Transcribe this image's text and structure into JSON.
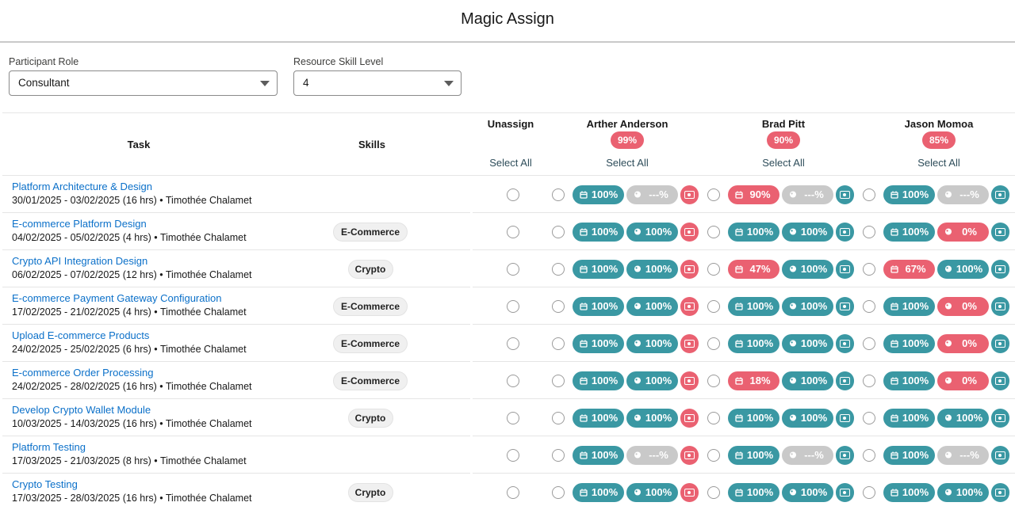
{
  "header": {
    "title": "Magic Assign"
  },
  "filters": {
    "role": {
      "label": "Participant Role",
      "value": "Consultant"
    },
    "skill_level": {
      "label": "Resource Skill Level",
      "value": "4"
    }
  },
  "columns": {
    "task": "Task",
    "skills": "Skills",
    "unassign": {
      "name": "Unassign",
      "select_all": "Select All"
    },
    "resources": [
      {
        "name": "Arther Anderson",
        "match": "99%",
        "select_all": "Select All"
      },
      {
        "name": "Brad Pitt",
        "match": "90%",
        "select_all": "Select All"
      },
      {
        "name": "Jason Momoa",
        "match": "85%",
        "select_all": "Select All"
      }
    ]
  },
  "legend_icons": {
    "availability": "calendar-icon",
    "skill": "skill-badge-icon",
    "cost": "money-icon"
  },
  "status_colors": {
    "good": "#3a98a3",
    "bad": "#ea6171",
    "na": "#c9c9c9",
    "link": "#0b70c9"
  },
  "tasks": [
    {
      "name": "Platform Architecture & Design",
      "dates": "30/01/2025 - 03/02/2025 (16 hrs)",
      "owner": "Timothée Chalamet",
      "skill": "",
      "cells": [
        {
          "avail": "100%",
          "avail_s": "good",
          "skill": "---%",
          "skill_s": "na",
          "cost_s": "bad"
        },
        {
          "avail": "90%",
          "avail_s": "bad",
          "skill": "---%",
          "skill_s": "na",
          "cost_s": "good"
        },
        {
          "avail": "100%",
          "avail_s": "good",
          "skill": "---%",
          "skill_s": "na",
          "cost_s": "good"
        }
      ]
    },
    {
      "name": "E-commerce Platform Design",
      "dates": "04/02/2025 - 05/02/2025 (4 hrs)",
      "owner": "Timothée Chalamet",
      "skill": "E-Commerce",
      "cells": [
        {
          "avail": "100%",
          "avail_s": "good",
          "skill": "100%",
          "skill_s": "good",
          "cost_s": "bad"
        },
        {
          "avail": "100%",
          "avail_s": "good",
          "skill": "100%",
          "skill_s": "good",
          "cost_s": "good"
        },
        {
          "avail": "100%",
          "avail_s": "good",
          "skill": "0%",
          "skill_s": "bad",
          "cost_s": "good"
        }
      ]
    },
    {
      "name": "Crypto API Integration Design",
      "dates": "06/02/2025 - 07/02/2025 (12 hrs)",
      "owner": "Timothée Chalamet",
      "skill": "Crypto",
      "cells": [
        {
          "avail": "100%",
          "avail_s": "good",
          "skill": "100%",
          "skill_s": "good",
          "cost_s": "bad"
        },
        {
          "avail": "47%",
          "avail_s": "bad",
          "skill": "100%",
          "skill_s": "good",
          "cost_s": "good"
        },
        {
          "avail": "67%",
          "avail_s": "bad",
          "skill": "100%",
          "skill_s": "good",
          "cost_s": "good"
        }
      ]
    },
    {
      "name": "E-commerce Payment Gateway Configuration",
      "dates": "17/02/2025 - 21/02/2025 (4 hrs)",
      "owner": "Timothée Chalamet",
      "skill": "E-Commerce",
      "cells": [
        {
          "avail": "100%",
          "avail_s": "good",
          "skill": "100%",
          "skill_s": "good",
          "cost_s": "bad"
        },
        {
          "avail": "100%",
          "avail_s": "good",
          "skill": "100%",
          "skill_s": "good",
          "cost_s": "good"
        },
        {
          "avail": "100%",
          "avail_s": "good",
          "skill": "0%",
          "skill_s": "bad",
          "cost_s": "good"
        }
      ]
    },
    {
      "name": "Upload E-commerce Products",
      "dates": "24/02/2025 - 25/02/2025 (6 hrs)",
      "owner": "Timothée Chalamet",
      "skill": "E-Commerce",
      "cells": [
        {
          "avail": "100%",
          "avail_s": "good",
          "skill": "100%",
          "skill_s": "good",
          "cost_s": "bad"
        },
        {
          "avail": "100%",
          "avail_s": "good",
          "skill": "100%",
          "skill_s": "good",
          "cost_s": "good"
        },
        {
          "avail": "100%",
          "avail_s": "good",
          "skill": "0%",
          "skill_s": "bad",
          "cost_s": "good"
        }
      ]
    },
    {
      "name": "E-commerce Order Processing",
      "dates": "24/02/2025 - 28/02/2025 (16 hrs)",
      "owner": "Timothée Chalamet",
      "skill": "E-Commerce",
      "cells": [
        {
          "avail": "100%",
          "avail_s": "good",
          "skill": "100%",
          "skill_s": "good",
          "cost_s": "bad"
        },
        {
          "avail": "18%",
          "avail_s": "bad",
          "skill": "100%",
          "skill_s": "good",
          "cost_s": "good"
        },
        {
          "avail": "100%",
          "avail_s": "good",
          "skill": "0%",
          "skill_s": "bad",
          "cost_s": "good"
        }
      ]
    },
    {
      "name": "Develop Crypto Wallet Module",
      "dates": "10/03/2025 - 14/03/2025 (16 hrs)",
      "owner": "Timothée Chalamet",
      "skill": "Crypto",
      "cells": [
        {
          "avail": "100%",
          "avail_s": "good",
          "skill": "100%",
          "skill_s": "good",
          "cost_s": "bad"
        },
        {
          "avail": "100%",
          "avail_s": "good",
          "skill": "100%",
          "skill_s": "good",
          "cost_s": "good"
        },
        {
          "avail": "100%",
          "avail_s": "good",
          "skill": "100%",
          "skill_s": "good",
          "cost_s": "good"
        }
      ]
    },
    {
      "name": "Platform Testing",
      "dates": "17/03/2025 - 21/03/2025 (8 hrs)",
      "owner": "Timothée Chalamet",
      "skill": "",
      "cells": [
        {
          "avail": "100%",
          "avail_s": "good",
          "skill": "---%",
          "skill_s": "na",
          "cost_s": "bad"
        },
        {
          "avail": "100%",
          "avail_s": "good",
          "skill": "---%",
          "skill_s": "na",
          "cost_s": "good"
        },
        {
          "avail": "100%",
          "avail_s": "good",
          "skill": "---%",
          "skill_s": "na",
          "cost_s": "good"
        }
      ]
    },
    {
      "name": "Crypto Testing",
      "dates": "17/03/2025 - 28/03/2025 (16 hrs)",
      "owner": "Timothée Chalamet",
      "skill": "Crypto",
      "cells": [
        {
          "avail": "100%",
          "avail_s": "good",
          "skill": "100%",
          "skill_s": "good",
          "cost_s": "bad"
        },
        {
          "avail": "100%",
          "avail_s": "good",
          "skill": "100%",
          "skill_s": "good",
          "cost_s": "good"
        },
        {
          "avail": "100%",
          "avail_s": "good",
          "skill": "100%",
          "skill_s": "good",
          "cost_s": "good"
        }
      ]
    }
  ]
}
